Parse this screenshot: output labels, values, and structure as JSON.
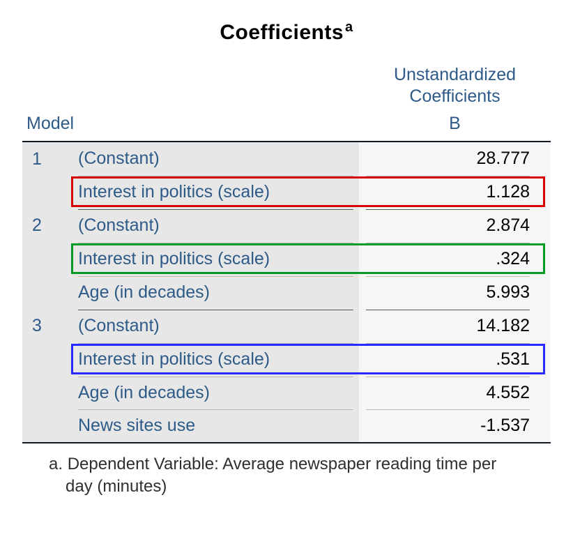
{
  "title": "Coefficients",
  "title_sup": "a",
  "headers": {
    "unstd_line1": "Unstandardized",
    "unstd_line2": "Coefficients",
    "model": "Model",
    "b": "B"
  },
  "models": [
    {
      "num": "1",
      "rows": [
        {
          "label": "(Constant)",
          "value": "28.777",
          "highlight": null
        },
        {
          "label": "Interest in politics (scale)",
          "value": "1.128",
          "highlight": "#d80000"
        }
      ]
    },
    {
      "num": "2",
      "rows": [
        {
          "label": "(Constant)",
          "value": "2.874",
          "highlight": null
        },
        {
          "label": "Interest in politics (scale)",
          "value": ".324",
          "highlight": "#009a24"
        },
        {
          "label": "Age (in decades)",
          "value": "5.993",
          "highlight": null
        }
      ]
    },
    {
      "num": "3",
      "rows": [
        {
          "label": "(Constant)",
          "value": "14.182",
          "highlight": null
        },
        {
          "label": "Interest in politics (scale)",
          "value": ".531",
          "highlight": "#2a2aff"
        },
        {
          "label": "Age (in decades)",
          "value": "4.552",
          "highlight": null
        },
        {
          "label": "News sites use",
          "value": "-1.537",
          "highlight": null
        }
      ]
    }
  ],
  "footnote_prefix": "a. ",
  "footnote": "Dependent Variable: Average newspaper reading time per day (minutes)"
}
